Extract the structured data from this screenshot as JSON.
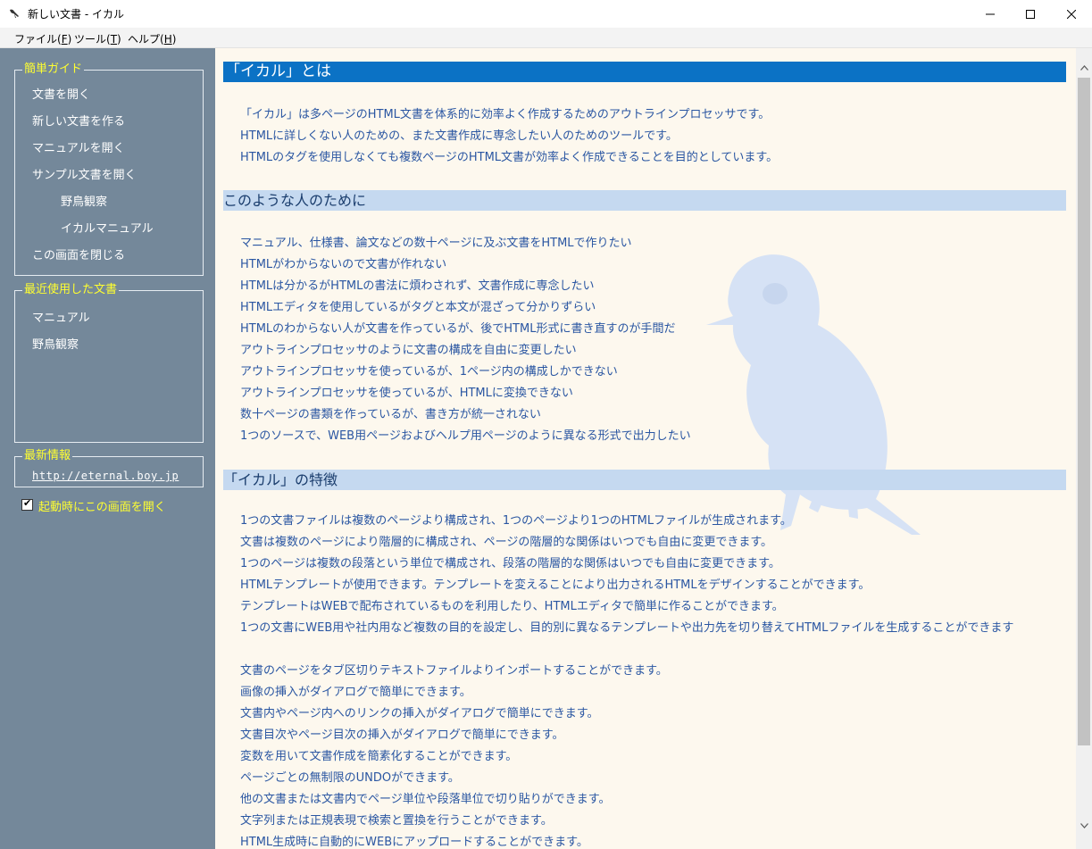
{
  "window": {
    "title": "新しい文書 - イカル"
  },
  "menu": {
    "file": {
      "label": "ファイル(",
      "key": "F",
      "tail": ")"
    },
    "tools": {
      "label": "ツール(",
      "key": "T",
      "tail": ")"
    },
    "help": {
      "label": "ヘルプ(",
      "key": "H",
      "tail": ")"
    }
  },
  "sidebar": {
    "quick_guide": {
      "title": "簡単ガイド",
      "items": [
        "文書を開く",
        "新しい文書を作る",
        "マニュアルを開く",
        "サンプル文書を開く",
        "野鳥観察",
        "イカルマニュアル",
        "この画面を閉じる"
      ]
    },
    "recent": {
      "title": "最近使用した文書",
      "items": [
        "マニュアル",
        "野鳥観察"
      ]
    },
    "news": {
      "title": "最新情報",
      "url": "http://eternal.boy.jp"
    },
    "startup_checkbox": {
      "label": "起動時にこの画面を開く",
      "checked": true
    }
  },
  "content": {
    "section1": {
      "heading": "「イカル」とは",
      "lines": [
        "「イカル」は多ページのHTML文書を体系的に効率よく作成するためのアウトラインプロセッサです。",
        "HTMLに詳しくない人のための、また文書作成に専念したい人のためのツールです。",
        "HTMLのタグを使用しなくても複数ページのHTML文書が効率よく作成できることを目的としています。"
      ]
    },
    "section2": {
      "heading": "このような人のために",
      "lines": [
        "マニュアル、仕様書、論文などの数十ページに及ぶ文書をHTMLで作りたい",
        "HTMLがわからないので文書が作れない",
        "HTMLは分かるがHTMLの書法に煩わされず、文書作成に専念したい",
        "HTMLエディタを使用しているがタグと本文が混ざって分かりずらい",
        "HTMLのわからない人が文書を作っているが、後でHTML形式に書き直すのが手間だ",
        "アウトラインプロセッサのように文書の構成を自由に変更したい",
        "アウトラインプロセッサを使っているが、1ページ内の構成しかできない",
        "アウトラインプロセッサを使っているが、HTMLに変換できない",
        "数十ページの書類を作っているが、書き方が統一されない",
        "1つのソースで、WEB用ページおよびヘルプ用ページのように異なる形式で出力したい"
      ]
    },
    "section3": {
      "heading": "「イカル」の特徴",
      "lines": [
        "1つの文書ファイルは複数のページより構成され、1つのページより1つのHTMLファイルが生成されます。",
        "文書は複数のページにより階層的に構成され、ページの階層的な関係はいつでも自由に変更できます。",
        "1つのページは複数の段落という単位で構成され、段落の階層的な関係はいつでも自由に変更できます。",
        "HTMLテンプレートが使用できます。テンプレートを変えることにより出力されるHTMLをデザインすることができます。",
        "テンプレートはWEBで配布されているものを利用したり、HTMLエディタで簡単に作ることができます。",
        "1つの文書にWEB用や社内用など複数の目的を設定し、目的別に異なるテンプレートや出力先を切り替えてHTMLファイルを生成することができます",
        "文書のページをタブ区切りテキストファイルよりインポートすることができます。",
        "画像の挿入がダイアログで簡単にできます。",
        "文書内やページ内へのリンクの挿入がダイアログで簡単にできます。",
        "文書目次やページ目次の挿入がダイアログで簡単にできます。",
        "変数を用いて文書作成を簡素化することができます。",
        "ページごとの無制限のUNDOができます。",
        "他の文書または文書内でページ単位や段落単位で切り貼りができます。",
        "文字列または正規表現で検索と置換を行うことができます。",
        "HTML生成時に自動的にWEBにアップロードすることができます。"
      ]
    }
  },
  "colors": {
    "sidebar_bg": "#74889a",
    "content_bg": "#fdf8ee",
    "heading_primary_bg": "#0b72c5",
    "heading_sub_bg": "#c5d9f0",
    "accent_yellow": "#ffff30",
    "body_text": "#2a56a2"
  },
  "icons": [
    "bird-app-icon",
    "minimize-icon",
    "maximize-icon",
    "close-icon",
    "checkbox-check-icon",
    "scroll-up-icon",
    "scroll-down-icon",
    "bird-watermark"
  ]
}
